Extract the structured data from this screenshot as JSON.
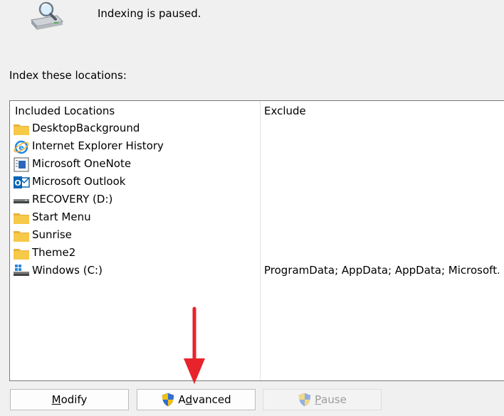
{
  "status": {
    "icon": "indexing-drive-magnifier-icon",
    "text": "Indexing is paused."
  },
  "locations_label": "Index these locations:",
  "table": {
    "columns": {
      "included": "Included Locations",
      "exclude": "Exclude"
    },
    "rows": [
      {
        "icon": "folder-icon",
        "name": "DesktopBackground",
        "exclude": ""
      },
      {
        "icon": "internet-explorer-icon",
        "name": "Internet Explorer History",
        "exclude": ""
      },
      {
        "icon": "onenote-icon",
        "name": "Microsoft OneNote",
        "exclude": ""
      },
      {
        "icon": "outlook-icon",
        "name": "Microsoft Outlook",
        "exclude": ""
      },
      {
        "icon": "drive-icon",
        "name": "RECOVERY (D:)",
        "exclude": ""
      },
      {
        "icon": "folder-icon",
        "name": "Start Menu",
        "exclude": ""
      },
      {
        "icon": "folder-icon",
        "name": "Sunrise",
        "exclude": ""
      },
      {
        "icon": "folder-icon",
        "name": "Theme2",
        "exclude": ""
      },
      {
        "icon": "windows-drive-icon",
        "name": "Windows (C:)",
        "exclude": "ProgramData; AppData; AppData; Microsoft..."
      }
    ]
  },
  "buttons": {
    "modify": {
      "access_key": "M",
      "rest": "odify"
    },
    "advanced": {
      "before": "A",
      "access_key": "d",
      "rest": "vanced",
      "icon": "uac-shield-icon"
    },
    "pause": {
      "access_key": "P",
      "rest": "ause",
      "icon": "uac-shield-icon",
      "disabled": true
    }
  },
  "annotation": {
    "icon": "red-arrow-down-icon",
    "color": "#e8232b"
  },
  "colors": {
    "folder": "#f7c948",
    "arrow": "#e8232b",
    "window_bg": "#f0f0f0"
  }
}
